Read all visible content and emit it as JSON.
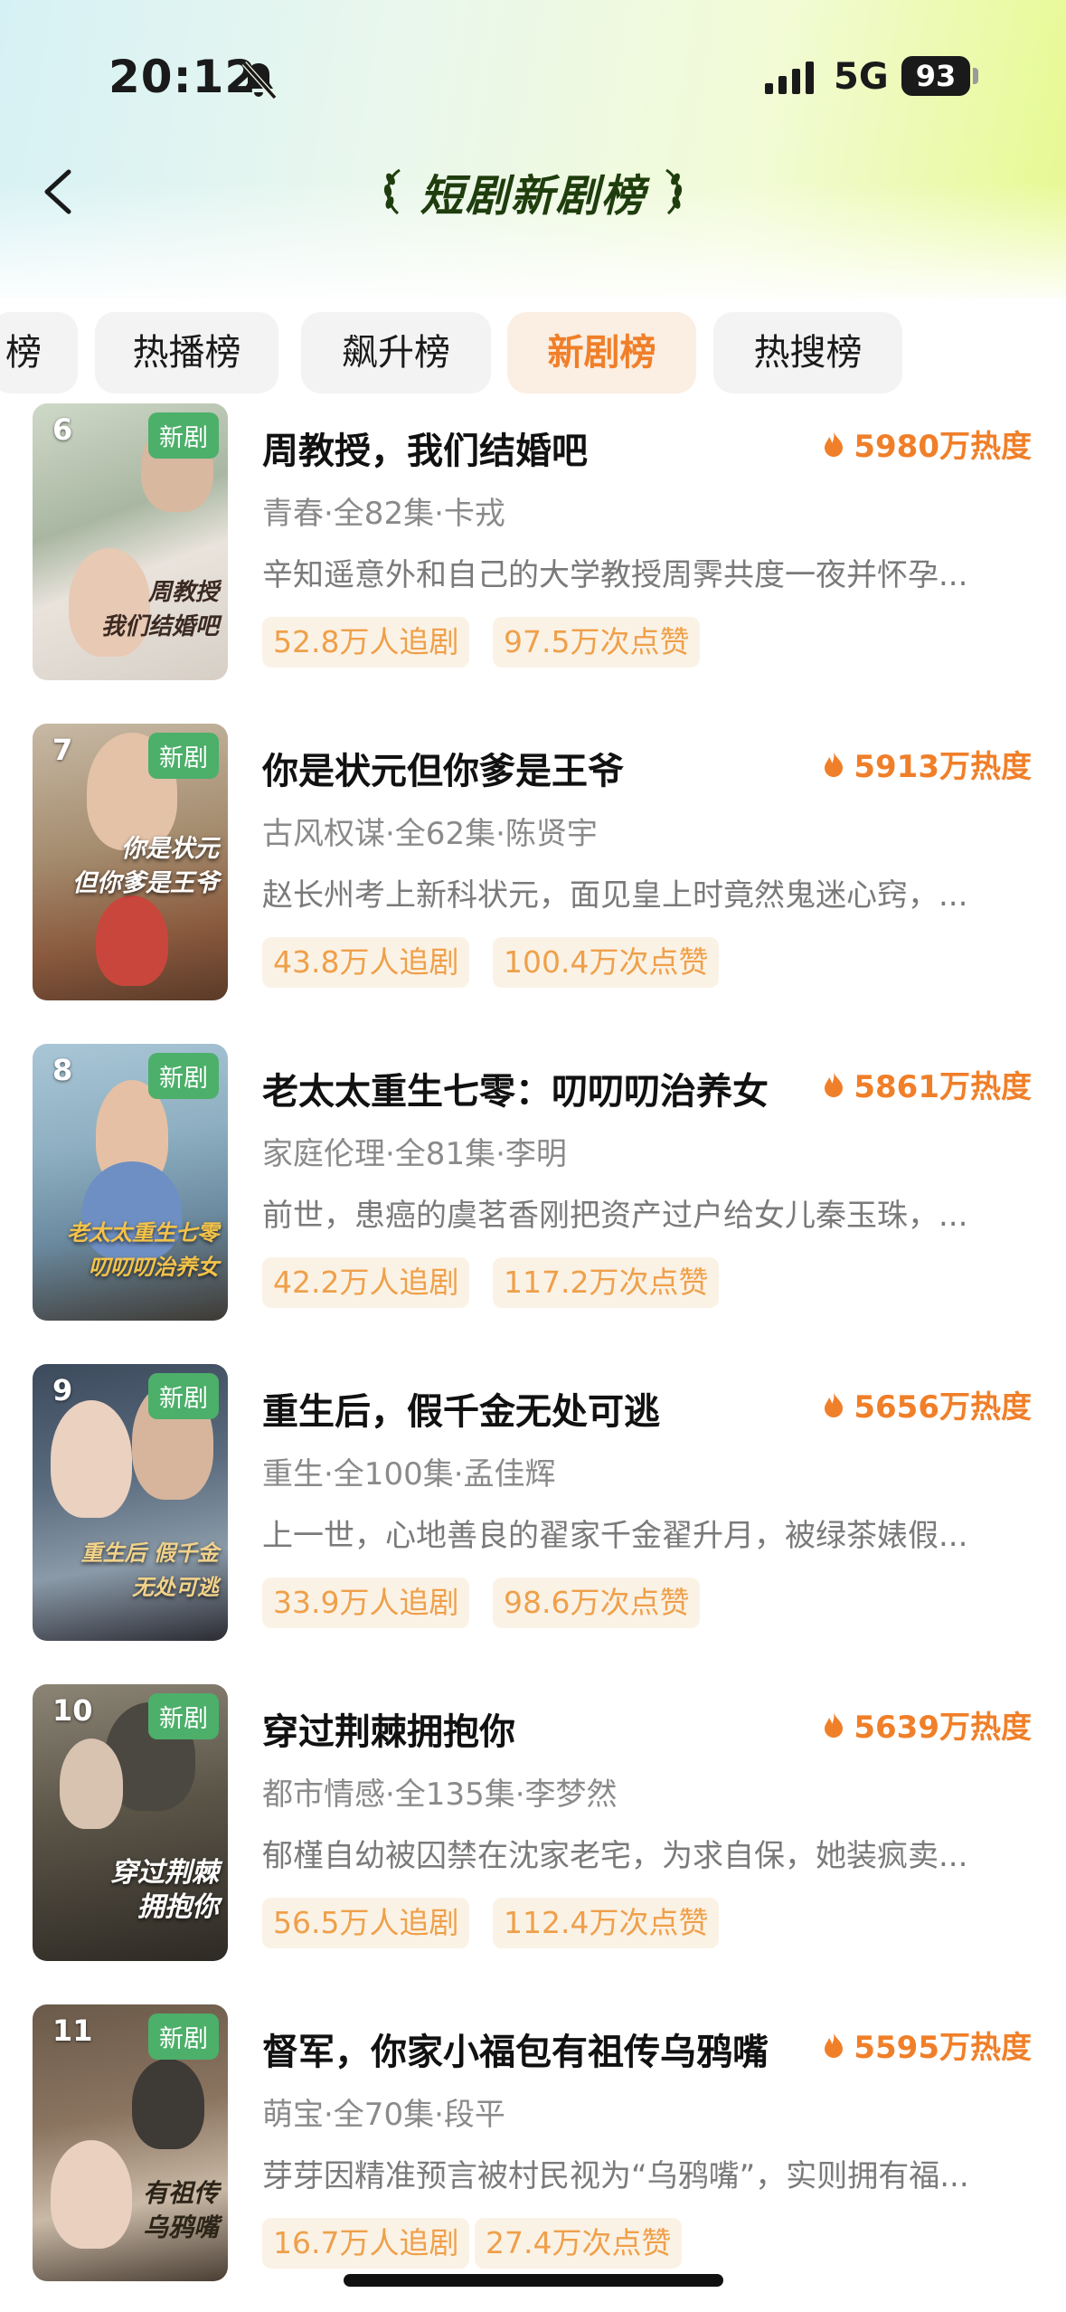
{
  "status_bar": {
    "time": "20:12",
    "network": "5G",
    "battery": "93"
  },
  "nav": {
    "title": "短剧新剧榜"
  },
  "tabs": [
    {
      "label": "榜",
      "active": false
    },
    {
      "label": "热播榜",
      "active": false
    },
    {
      "label": "飙升榜",
      "active": false
    },
    {
      "label": "新剧榜",
      "active": true
    },
    {
      "label": "热搜榜",
      "active": false
    }
  ],
  "colors": {
    "accent": "#f07f29",
    "badge_green": "#4caf6a",
    "tag_bg": "#fbf2e6",
    "tag_text": "#efa04a"
  },
  "items": [
    {
      "rank": "6",
      "badge": "新剧",
      "title": "周教授，我们结婚吧",
      "heat": "5980万热度",
      "meta": "青春·全82集·卡戎",
      "desc": "辛知遥意外和自己的大学教授周霁共度一夜并怀孕...",
      "followers": "52.8万人追剧",
      "likes": "97.5万次点赞",
      "poster_text": "周教授\n我们结婚吧"
    },
    {
      "rank": "7",
      "badge": "新剧",
      "title": "你是状元但你爹是王爷",
      "heat": "5913万热度",
      "meta": "古风权谋·全62集·陈贤宇",
      "desc": "赵长州考上新科状元，面见皇上时竟然鬼迷心窍，...",
      "followers": "43.8万人追剧",
      "likes": "100.4万次点赞",
      "poster_text": "你是状元\n但你爹是王爷"
    },
    {
      "rank": "8",
      "badge": "新剧",
      "title": "老太太重生七零：叨叨叨治养女",
      "heat": "5861万热度",
      "meta": "家庭伦理·全81集·李明",
      "desc": "前世，患癌的虞茗香刚把资产过户给女儿秦玉珠，...",
      "followers": "42.2万人追剧",
      "likes": "117.2万次点赞",
      "poster_text": "老太太重生七零\n叨叨叨治养女"
    },
    {
      "rank": "9",
      "badge": "新剧",
      "title": "重生后，假千金无处可逃",
      "heat": "5656万热度",
      "meta": "重生·全100集·孟佳辉",
      "desc": "上一世，心地善良的翟家千金翟升月，被绿茶婊假...",
      "followers": "33.9万人追剧",
      "likes": "98.6万次点赞",
      "poster_text": "重生后 假千金\n无处可逃"
    },
    {
      "rank": "10",
      "badge": "新剧",
      "title": "穿过荆棘拥抱你",
      "heat": "5639万热度",
      "meta": "都市情感·全135集·李梦然",
      "desc": "郁槿自幼被囚禁在沈家老宅，为求自保，她装疯卖...",
      "followers": "56.5万人追剧",
      "likes": "112.4万次点赞",
      "poster_text": "穿过荆棘\n拥抱你"
    },
    {
      "rank": "11",
      "badge": "新剧",
      "title": "督军，你家小福包有祖传乌鸦嘴",
      "heat": "5595万热度",
      "meta": "萌宝·全70集·段平",
      "desc": "芽芽因精准预言被村民视为“乌鸦嘴”，实则拥有福...",
      "followers": "16.7万人追剧",
      "likes": "27.4万次点赞",
      "poster_text": "有祖传\n乌鸦嘴"
    }
  ]
}
